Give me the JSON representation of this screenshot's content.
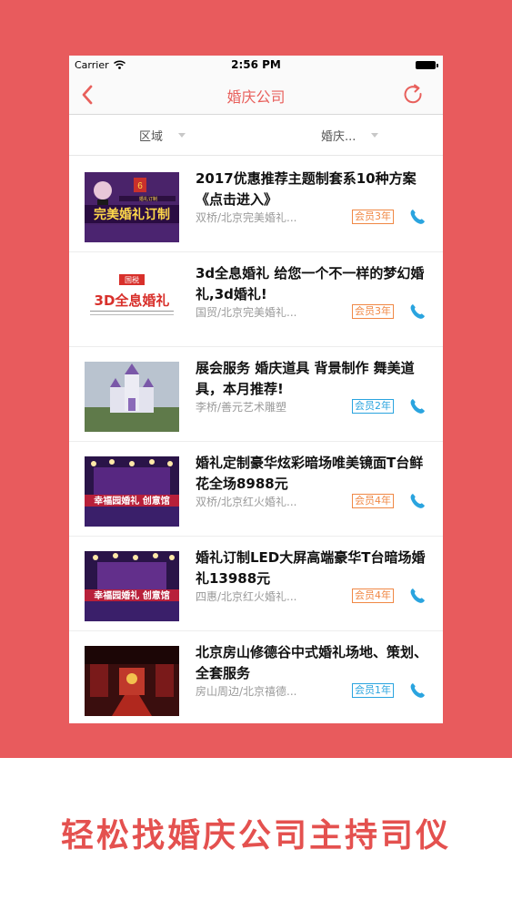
{
  "status_bar": {
    "carrier": "Carrier",
    "time": "2:56 PM"
  },
  "nav": {
    "title": "婚庆公司"
  },
  "filters": {
    "region": "区域",
    "category": "婚庆..."
  },
  "listings": [
    {
      "title": "2017优惠推荐主题制套系10种方案 《点击进入》",
      "meta": "双桥/北京完美婚礼...",
      "badge": "会员3年",
      "badge_color": "#f08845",
      "thumb": {
        "banner": "完美婚礼订制",
        "bg": "#3b1c5a"
      }
    },
    {
      "title": "3d全息婚礼 给您一个不一样的梦幻婚礼,3d婚礼!",
      "meta": "国贸/北京完美婚礼...",
      "badge": "会员3年",
      "badge_color": "#f08845",
      "thumb": {
        "tag": "国税",
        "banner": "3D全息婚礼",
        "bg": "#ffffff"
      }
    },
    {
      "title": "展会服务 婚庆道具 背景制作 舞美道具，本月推荐!",
      "meta": "李桥/善元艺术雕塑",
      "badge": "会员2年",
      "badge_color": "#2aa4df",
      "thumb": {
        "bg": "#aeb8c4"
      }
    },
    {
      "title": "婚礼定制豪华炫彩暗场唯美镜面T台鲜花全场8988元",
      "meta": "双桥/北京红火婚礼...",
      "badge": "会员4年",
      "badge_color": "#f08845",
      "thumb": {
        "banner": "幸福园婚礼 创意馆",
        "bg": "#2a1448"
      }
    },
    {
      "title": "婚礼订制LED大屏高端豪华T台暗场婚礼13988元",
      "meta": "四惠/北京红火婚礼...",
      "badge": "会员4年",
      "badge_color": "#f08845",
      "thumb": {
        "banner": "幸福园婚礼 创意馆",
        "bg": "#2a1448"
      }
    },
    {
      "title": "北京房山修德谷中式婚礼场地、策划、全套服务",
      "meta": "房山周边/北京禧德...",
      "badge": "会员1年",
      "badge_color": "#2aa4df",
      "thumb": {
        "bg": "#3a0e0e"
      }
    }
  ],
  "tagline": "轻松找婚庆公司主持司仪"
}
